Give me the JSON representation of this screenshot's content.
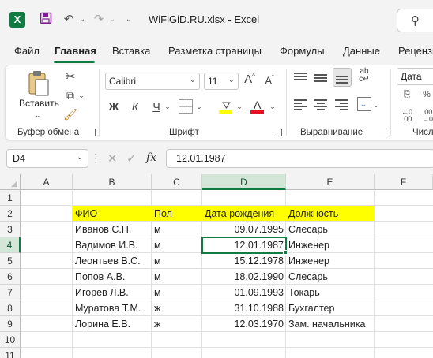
{
  "window": {
    "title": "WiFiGiD.RU.xlsx  -  Excel",
    "app_icon_letter": "X"
  },
  "tabs": [
    "Файл",
    "Главная",
    "Вставка",
    "Разметка страницы",
    "Формулы",
    "Данные",
    "Рецензи"
  ],
  "active_tab": "Главная",
  "ribbon": {
    "clipboard": {
      "label": "Буфер обмена",
      "paste_label": "Вставить"
    },
    "font": {
      "label": "Шрифт",
      "name": "Calibri",
      "size": "11",
      "bold": "Ж",
      "italic": "К",
      "underline": "Ч",
      "font_color_letter": "A"
    },
    "alignment": {
      "label": "Выравнивание"
    },
    "number": {
      "label": "Числ",
      "format": "Дата"
    }
  },
  "formula_bar": {
    "name_box": "D4",
    "fx": "fx",
    "value": "12.01.1987"
  },
  "columns": [
    "A",
    "B",
    "C",
    "D",
    "E",
    "F"
  ],
  "selected_column": "D",
  "rows": [
    "1",
    "2",
    "3",
    "4",
    "5",
    "6",
    "7",
    "8",
    "9",
    "10",
    "11"
  ],
  "selected_row": "4",
  "table": {
    "headers": [
      "ФИО",
      "Пол",
      "Дата рождения",
      "Должность"
    ],
    "records": [
      [
        "Иванов С.П.",
        "м",
        "09.07.1995",
        "Слесарь"
      ],
      [
        "Вадимов И.В.",
        "м",
        "12.01.1987",
        "Инженер"
      ],
      [
        "Леонтьев В.С.",
        "м",
        "15.12.1978",
        "Инженер"
      ],
      [
        "Попов А.В.",
        "м",
        "18.02.1990",
        "Слесарь"
      ],
      [
        "Игорев Л.В.",
        "м",
        "01.09.1993",
        "Токарь"
      ],
      [
        "Муратова Т.М.",
        "ж",
        "31.10.1988",
        "Бухгалтер"
      ],
      [
        "Лорина Е.В.",
        "ж",
        "12.03.1970",
        "Зам. начальника"
      ]
    ]
  },
  "colors": {
    "accent": "#107c41",
    "header_fill": "#ffff00"
  }
}
